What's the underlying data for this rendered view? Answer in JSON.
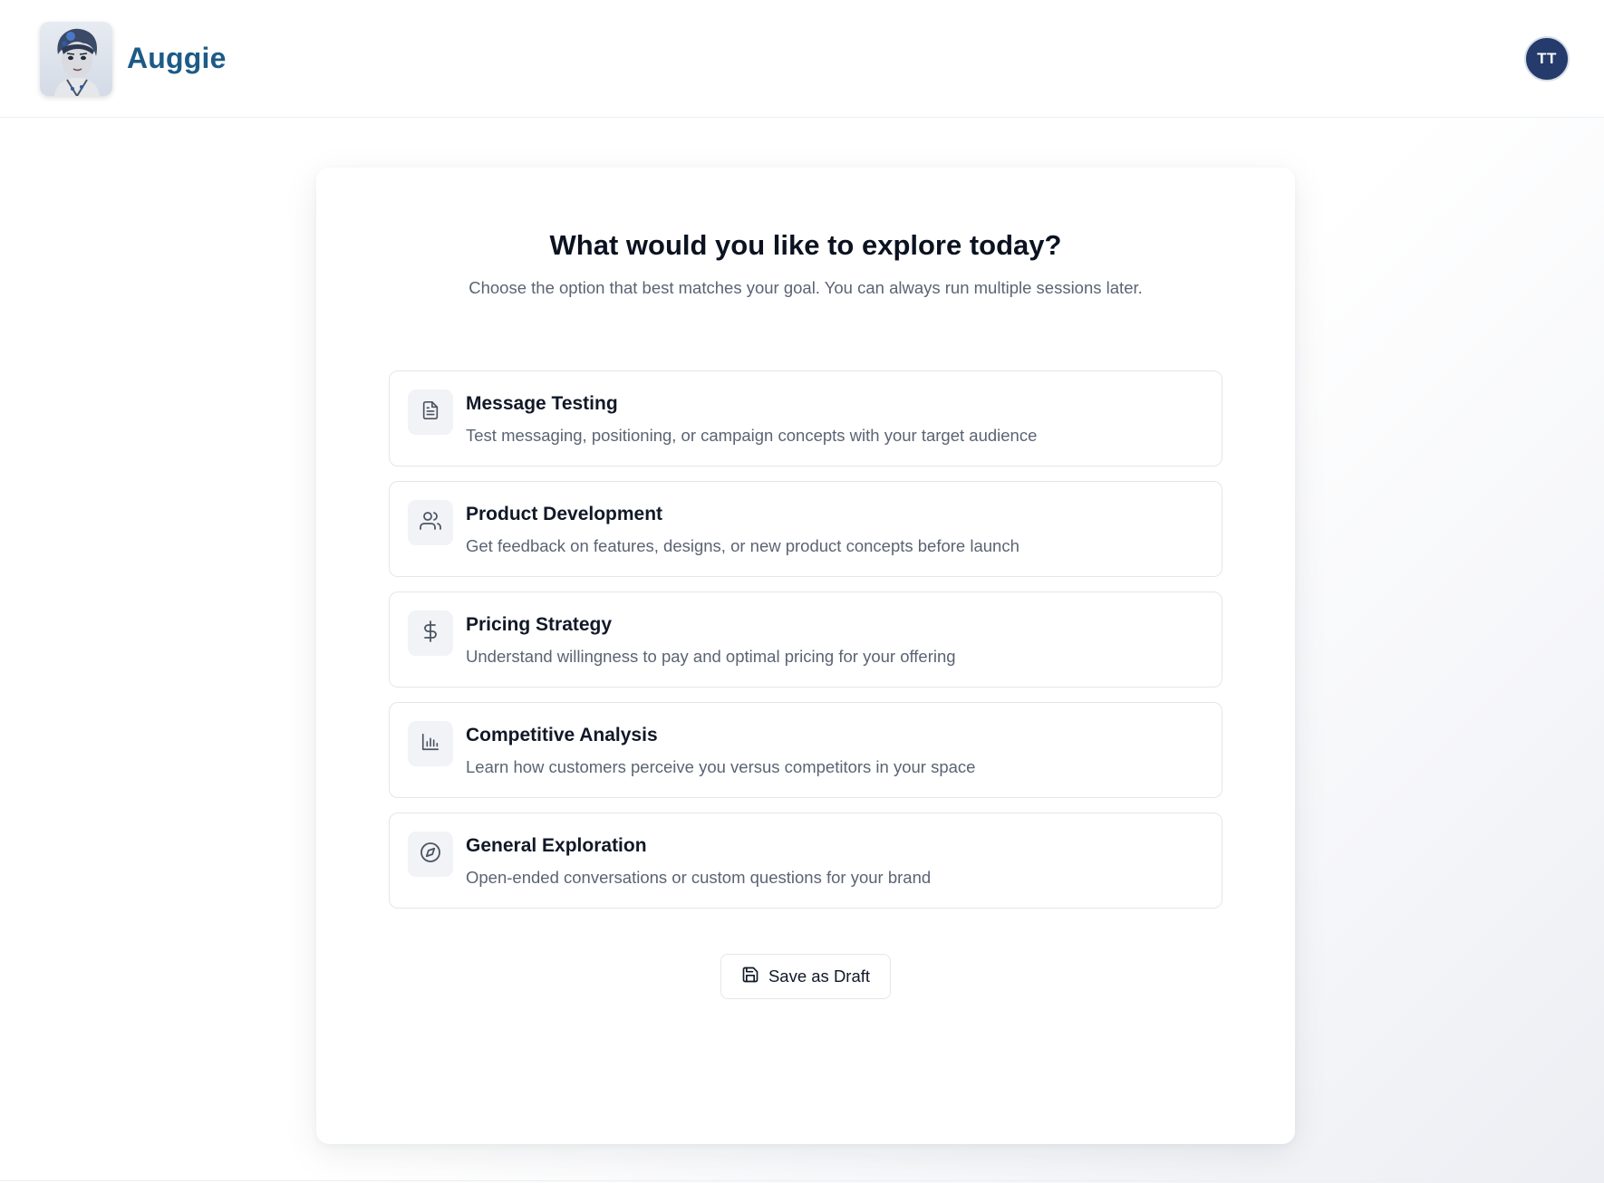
{
  "header": {
    "brand_name": "Auggie",
    "user_initials": "TT"
  },
  "main": {
    "title": "What would you like to explore today?",
    "subtitle": "Choose the option that best matches your goal. You can always run multiple sessions later.",
    "options": [
      {
        "label": "Message Testing",
        "description": "Test messaging, positioning, or campaign concepts with your target audience",
        "icon": "document-icon"
      },
      {
        "label": "Product Development",
        "description": "Get feedback on features, designs, or new product concepts before launch",
        "icon": "users-icon"
      },
      {
        "label": "Pricing Strategy",
        "description": "Understand willingness to pay and optimal pricing for your offering",
        "icon": "dollar-icon"
      },
      {
        "label": "Competitive Analysis",
        "description": "Learn how customers perceive you versus competitors in your space",
        "icon": "bar-chart-icon"
      },
      {
        "label": "General Exploration",
        "description": "Open-ended conversations or custom questions for your brand",
        "icon": "compass-icon"
      }
    ],
    "save_draft_label": "Save as Draft"
  },
  "colors": {
    "brand": "#1d5b87",
    "avatar_bg": "#243b6b",
    "option_border": "#e3e6eb",
    "icon_box_bg": "#f1f3f6"
  }
}
